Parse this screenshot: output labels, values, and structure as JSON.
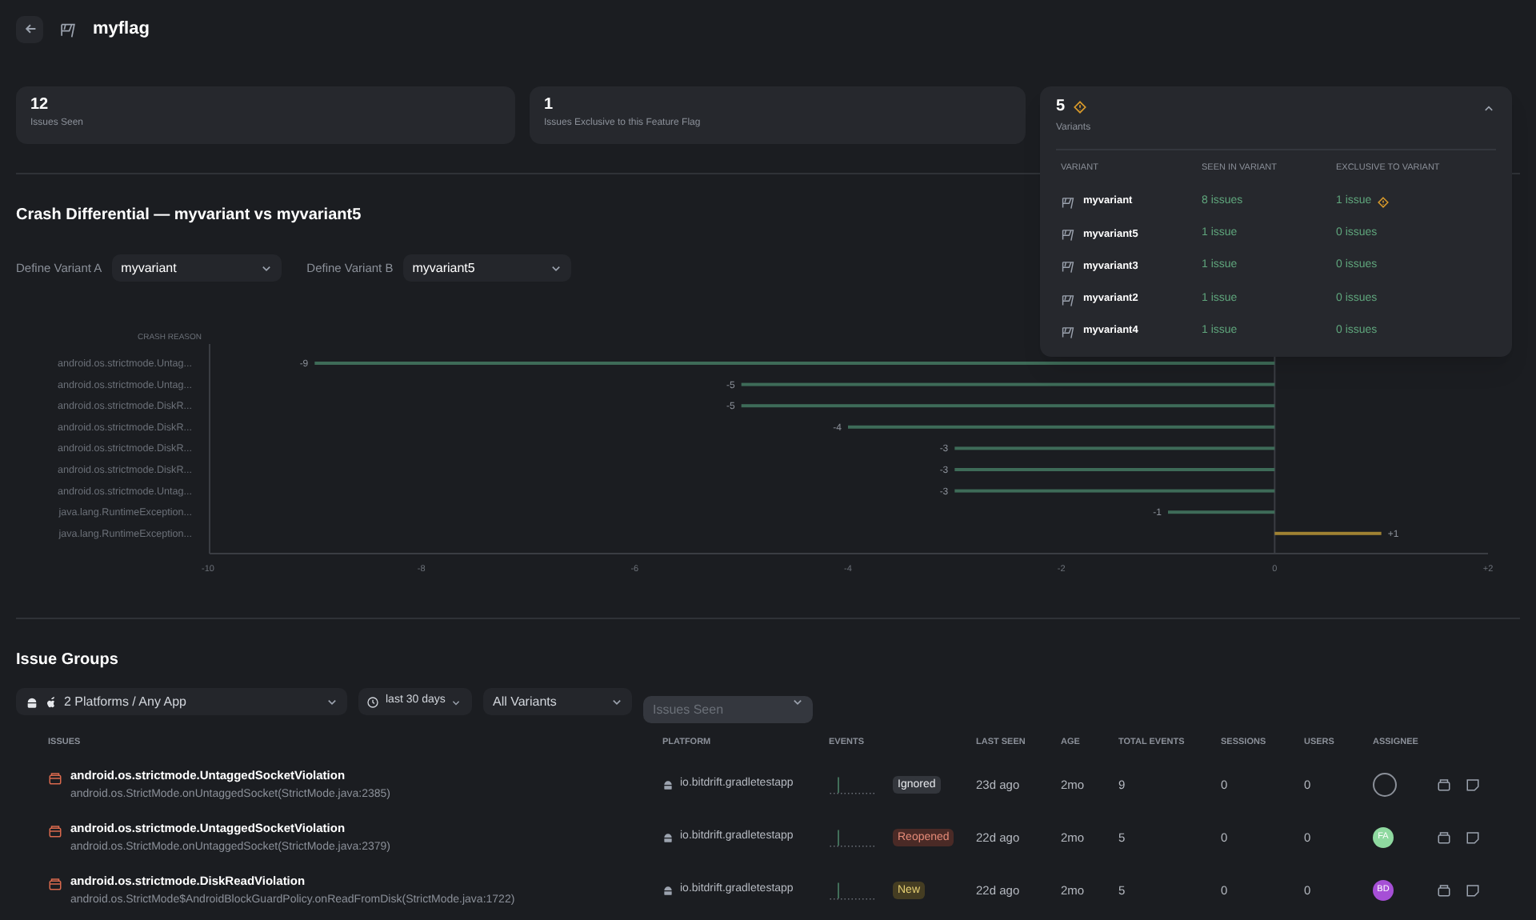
{
  "header": {
    "title": "myflag"
  },
  "stats": [
    {
      "value": "12",
      "label": "Issues Seen"
    },
    {
      "value": "1",
      "label": "Issues Exclusive to this Feature Flag"
    }
  ],
  "variants_panel": {
    "value": "5",
    "label": "Variants",
    "warning": true,
    "expanded": true,
    "columns": [
      "VARIANT",
      "SEEN IN VARIANT",
      "EXCLUSIVE TO VARIANT"
    ],
    "rows": [
      {
        "name": "myvariant",
        "seen": "8 issues",
        "exclusive": "1 issue",
        "warning": true
      },
      {
        "name": "myvariant5",
        "seen": "1 issue",
        "exclusive": "0 issues",
        "warning": false
      },
      {
        "name": "myvariant3",
        "seen": "1 issue",
        "exclusive": "0 issues",
        "warning": false
      },
      {
        "name": "myvariant2",
        "seen": "1 issue",
        "exclusive": "0 issues",
        "warning": false
      },
      {
        "name": "myvariant4",
        "seen": "1 issue",
        "exclusive": "0 issues",
        "warning": false
      }
    ]
  },
  "crash_differential": {
    "title": "Crash Differential — myvariant vs myvariant5",
    "variant_a": {
      "label": "Define Variant A",
      "value": "myvariant"
    },
    "variant_b": {
      "label": "Define Variant B",
      "value": "myvariant5"
    },
    "chart_data": {
      "type": "bar",
      "orientation": "horizontal",
      "ylabel": "CRASH REASON",
      "categories": [
        "android.os.strictmode.Untag...",
        "android.os.strictmode.Untag...",
        "android.os.strictmode.DiskR...",
        "android.os.strictmode.DiskR...",
        "android.os.strictmode.DiskR...",
        "android.os.strictmode.DiskR...",
        "android.os.strictmode.Untag...",
        "java.lang.RuntimeException...",
        "java.lang.RuntimeException..."
      ],
      "values": [
        -9,
        -5,
        -5,
        -4,
        -3,
        -3,
        -3,
        -1,
        1
      ],
      "xlim": [
        -10,
        2
      ],
      "xticks": [
        -10,
        -8,
        -6,
        -4,
        -2,
        0,
        {
          "value": 2,
          "label": "+2"
        }
      ],
      "value_labels": [
        "-9",
        "-5",
        "-5",
        "-4",
        "-3",
        "-3",
        "-3",
        "-1",
        "+1"
      ]
    }
  },
  "issue_groups": {
    "title": "Issue Groups",
    "filters": {
      "platform": "2 Platforms / Any App",
      "time": "last 30 days",
      "variant": "All Variants",
      "sort_placeholder": "Issues Seen"
    },
    "columns": [
      "ISSUES",
      "PLATFORM",
      "EVENTS",
      "",
      "LAST SEEN",
      "AGE",
      "TOTAL EVENTS",
      "SESSIONS",
      "USERS",
      "ASSIGNEE"
    ],
    "rows": [
      {
        "title": "android.os.strictmode.UntaggedSocketViolation",
        "detail": "android.os.StrictMode.onUntaggedSocket(StrictMode.java:2385)",
        "platform": "io.bitdrift.gradletestapp",
        "status": "Ignored",
        "kind": "ignored",
        "last_seen": "23d ago",
        "age": "2mo",
        "total_events": "9",
        "sessions": "0",
        "users": "0",
        "assignee": {
          "kind": "none"
        }
      },
      {
        "title": "android.os.strictmode.UntaggedSocketViolation",
        "detail": "android.os.StrictMode.onUntaggedSocket(StrictMode.java:2379)",
        "platform": "io.bitdrift.gradletestapp",
        "status": "Reopened",
        "kind": "reopened",
        "last_seen": "22d ago",
        "age": "2mo",
        "total_events": "5",
        "sessions": "0",
        "users": "0",
        "assignee": {
          "kind": "avatar",
          "initials": "FA",
          "color": "#8fd9a0"
        }
      },
      {
        "title": "android.os.strictmode.DiskReadViolation",
        "detail": "android.os.StrictMode$AndroidBlockGuardPolicy.onReadFromDisk(StrictMode.java:1722)",
        "platform": "io.bitdrift.gradletestapp",
        "status": "New",
        "kind": "new",
        "last_seen": "22d ago",
        "age": "2mo",
        "total_events": "5",
        "sessions": "0",
        "users": "0",
        "assignee": {
          "kind": "avatar",
          "initials": "BD",
          "color": "#a64fd6"
        }
      }
    ]
  }
}
